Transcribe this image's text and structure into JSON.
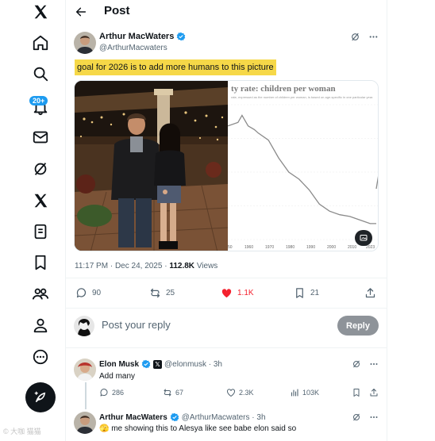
{
  "nav": {
    "notifications_badge": "20+"
  },
  "header": {
    "title": "Post"
  },
  "tweet": {
    "author_name": "Arthur MacWaters",
    "author_handle": "@ArthurMacwaters",
    "text": "goal for 2026 is to add more humans to this picture",
    "timestamp": "11:17 PM · Dec 24, 2025 · ",
    "views_count": "112.8K",
    "views_label": "Views",
    "stats": {
      "replies": "90",
      "reposts": "25",
      "likes": "1.1K",
      "bookmarks": "21"
    },
    "highlight_color": "#f6d848",
    "like_color": "#f4212e"
  },
  "media_chart": {
    "title": "ty rate: children per woman",
    "subtitle": "rate, expressed as the number of children per woman, is based on age-specific in one particular year.",
    "ticks": [
      "50",
      "1960",
      "1970",
      "1980",
      "1990",
      "2000",
      "2010",
      "2023"
    ]
  },
  "chart_data": {
    "type": "line",
    "title": "ty rate: children per woman",
    "x": [
      1950,
      1955,
      1957,
      1960,
      1963,
      1965,
      1970,
      1975,
      1980,
      1985,
      1990,
      1995,
      2000,
      2005,
      2010,
      2015,
      2020,
      2023
    ],
    "series": [
      {
        "values": [
          5.0,
          5.1,
          5.3,
          5.0,
          4.9,
          4.8,
          4.6,
          4.1,
          3.7,
          3.5,
          3.2,
          2.8,
          2.6,
          2.5,
          2.45,
          2.35,
          2.25,
          2.25
        ]
      }
    ]
  },
  "reply_box": {
    "placeholder": "Post your reply",
    "button": "Reply"
  },
  "replies": [
    {
      "name": "Elon Musk",
      "handle": "@elonmusk · 3h",
      "text": "Add many",
      "stats": {
        "replies": "286",
        "reposts": "67",
        "likes": "2.3K",
        "views": "103K"
      }
    },
    {
      "name": "Arthur MacWaters",
      "handle": "@ArthurMacwaters · 3h",
      "text": "🫣 me showing this to Alesya like see babe elon said so"
    }
  ],
  "watermark": "© 大咖 猫猫"
}
